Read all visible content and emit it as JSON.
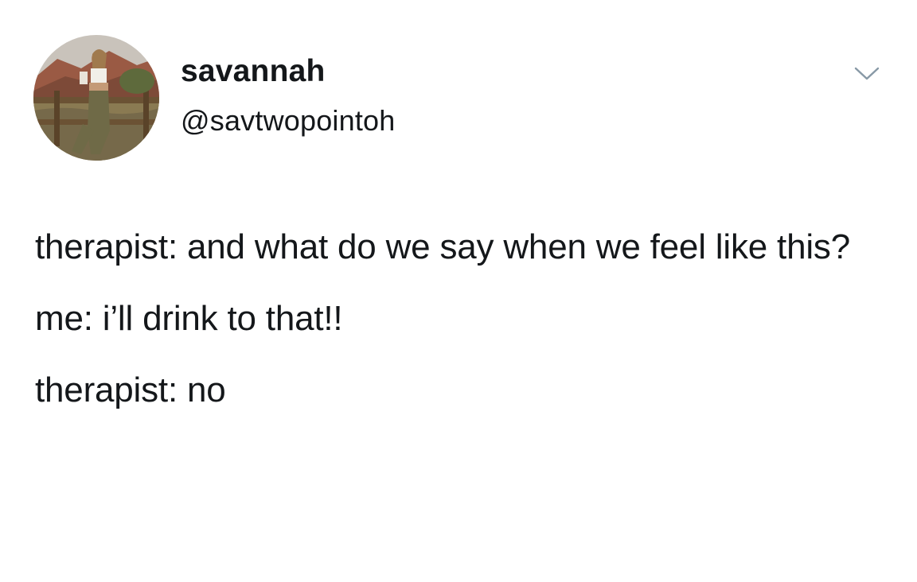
{
  "tweet": {
    "author": {
      "display_name": "savannah",
      "handle": "@savtwopointoh",
      "avatar_icon": "profile-photo"
    },
    "menu_icon": "chevron-down-icon",
    "lines": [
      "therapist: and what do we say when we feel like this?",
      "me: i’ll drink to that!!",
      "therapist: no"
    ]
  },
  "colors": {
    "background": "#ffffff",
    "text": "#14171a",
    "caret": "#8899a6"
  }
}
